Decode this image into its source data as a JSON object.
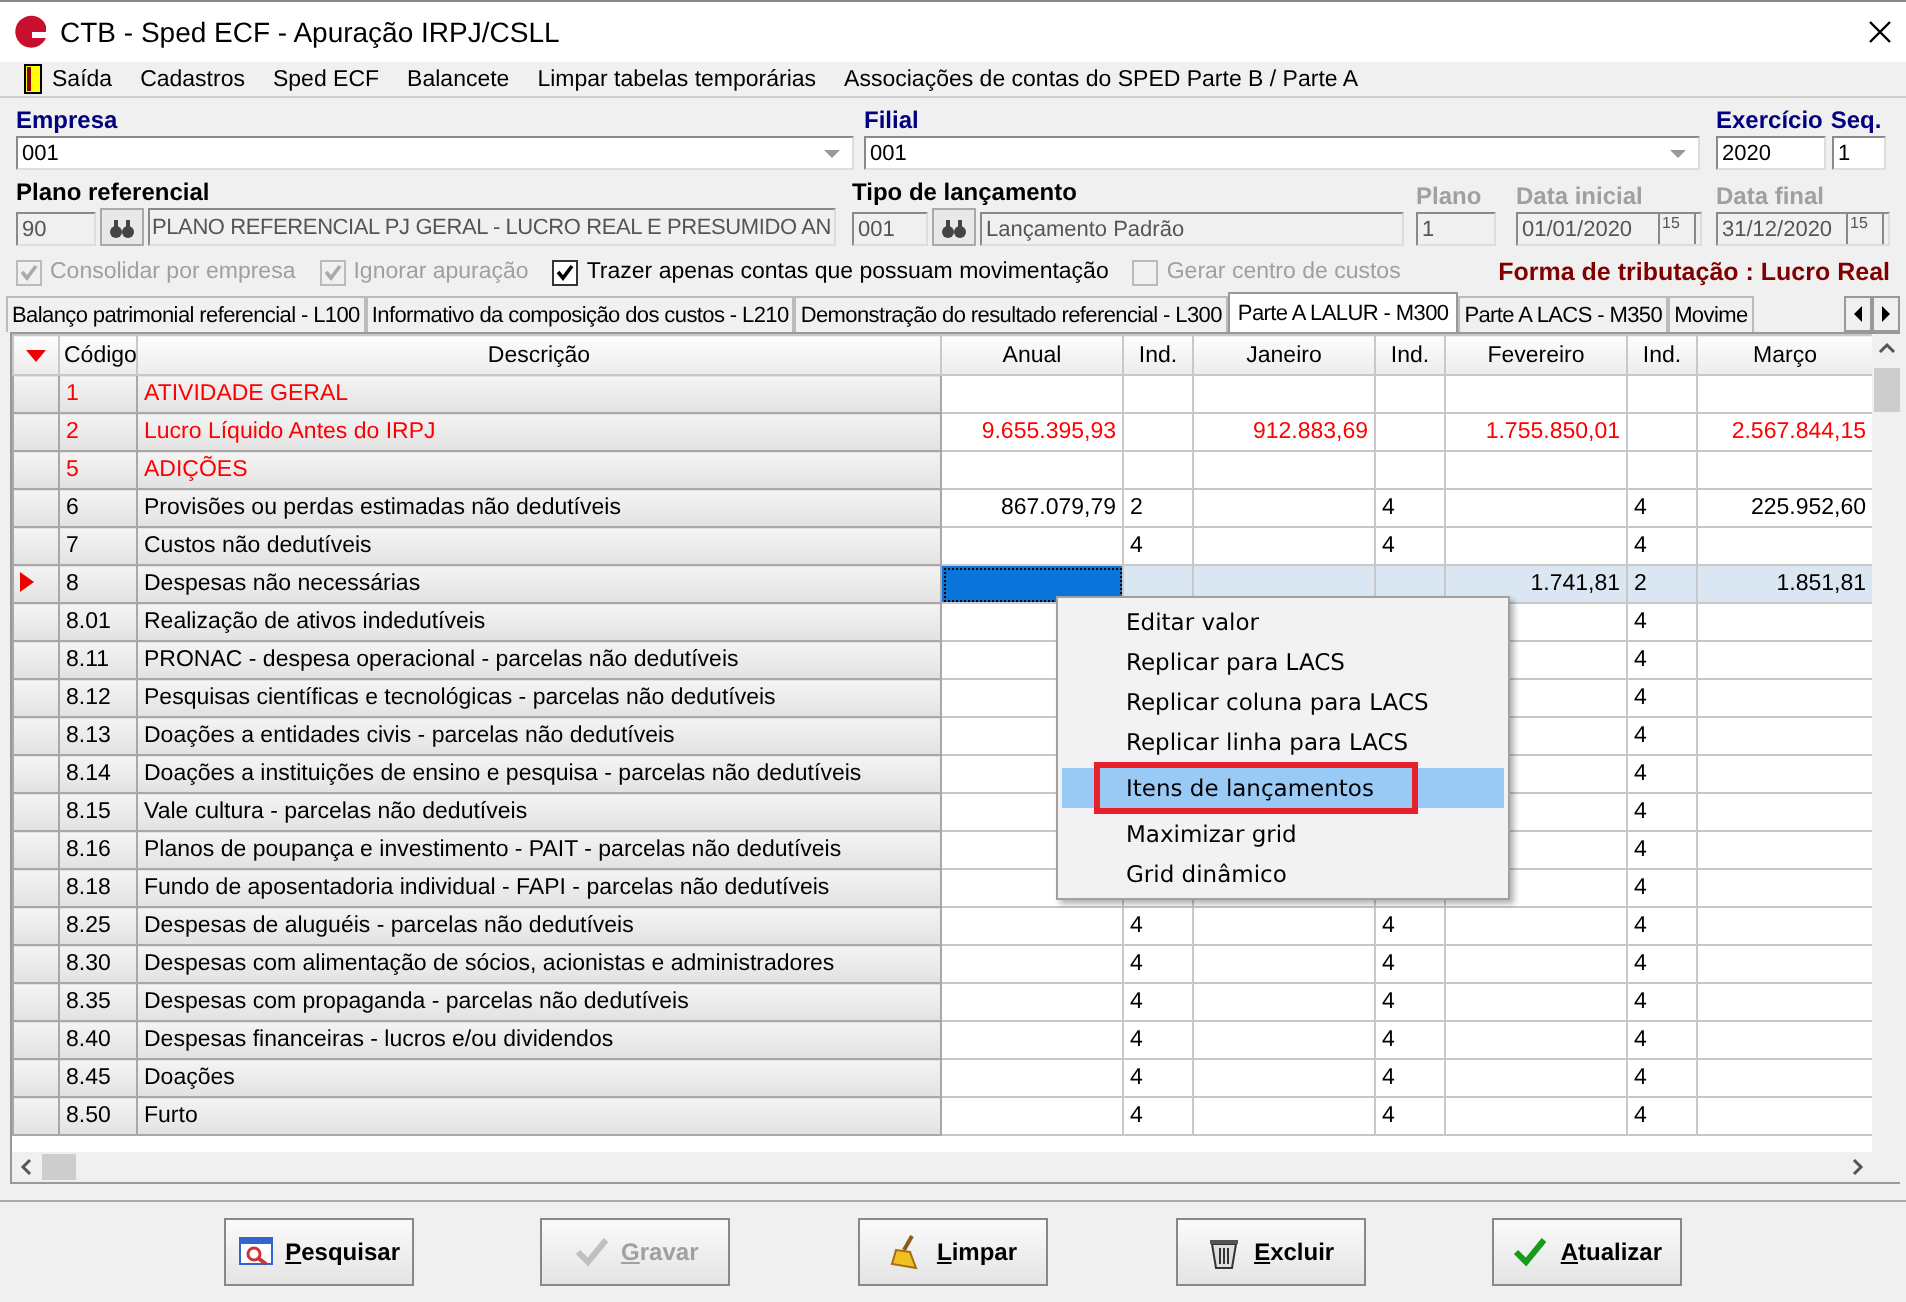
{
  "window": {
    "title": "CTB - Sped ECF - Apuração IRPJ/CSLL"
  },
  "menu_bar": [
    {
      "label": "Saída",
      "kind": "exit"
    },
    {
      "label": "Cadastros"
    },
    {
      "label": "Sped ECF"
    },
    {
      "label": "Balancete"
    },
    {
      "label": "Limpar tabelas temporárias"
    },
    {
      "label": "Associações de contas do SPED Parte B / Parte A"
    }
  ],
  "form": {
    "empresa": {
      "label": "Empresa",
      "value": "001"
    },
    "filial": {
      "label": "Filial",
      "value": "001"
    },
    "exercicio": {
      "label": "Exercício",
      "value": "2020"
    },
    "seq": {
      "label": "Seq.",
      "value": "1"
    },
    "plano_referencial": {
      "label": "Plano referencial",
      "code": "90",
      "value": "PLANO REFERENCIAL PJ GERAL - LUCRO REAL E PRESUMIDO AN"
    },
    "tipo_lancamento": {
      "label": "Tipo de lançamento",
      "code": "001",
      "value": "Lançamento Padrão"
    },
    "plano": {
      "label": "Plano",
      "value": "1",
      "disabled": true
    },
    "data_inicial": {
      "label": "Data inicial",
      "value": "01/01/2020",
      "disabled": true,
      "button": "15"
    },
    "data_final": {
      "label": "Data final",
      "value": "31/12/2020",
      "disabled": true,
      "button": "15"
    },
    "checkboxes": [
      {
        "label": "Consolidar por empresa",
        "checked": true,
        "disabled": true
      },
      {
        "label": "Ignorar apuração",
        "checked": true,
        "disabled": true
      },
      {
        "label": "Trazer apenas contas que possuam movimentação",
        "checked": true,
        "disabled": false
      },
      {
        "label": "Gerar centro de custos",
        "checked": false,
        "disabled": true
      }
    ],
    "forma_tributacao": "Forma de tributação : Lucro Real"
  },
  "tabs": [
    {
      "label": "Balanço patrimonial referencial - L100",
      "selected": false
    },
    {
      "label": "Informativo da composição dos custos - L210",
      "selected": false
    },
    {
      "label": "Demonstração do resultado referencial - L300",
      "selected": false
    },
    {
      "label": "Parte A LALUR - M300",
      "selected": true
    },
    {
      "label": "Parte A LACS - M350",
      "selected": false
    },
    {
      "label": "Movime",
      "selected": false
    }
  ],
  "table": {
    "columns": [
      "Código",
      "Descrição",
      "Anual",
      "Ind.",
      "Janeiro",
      "Ind.",
      "Fevereiro",
      "Ind.",
      "Março"
    ],
    "rows": [
      {
        "kind": "group",
        "current": false,
        "cells": [
          "1",
          "ATIVIDADE GERAL"
        ]
      },
      {
        "kind": "group",
        "current": false,
        "cells": [
          "2",
          "Lucro Líquido Antes do IRPJ",
          "9.655.395,93",
          null,
          "912.883,69",
          null,
          "1.755.850,01",
          null,
          "2.567.844,15"
        ]
      },
      {
        "kind": "group",
        "current": false,
        "cells": [
          "5",
          "ADIÇÕES"
        ]
      },
      {
        "kind": "item",
        "current": false,
        "cells": [
          "6",
          "Provisões ou perdas estimadas não dedutíveis",
          "867.079,79",
          "2",
          null,
          "4",
          null,
          "4",
          "225.952,60"
        ]
      },
      {
        "kind": "item",
        "current": false,
        "cells": [
          "7",
          "Custos não dedutíveis",
          null,
          "4",
          null,
          "4",
          null,
          "4"
        ]
      },
      {
        "kind": "item",
        "current": true,
        "cells": [
          "8",
          "Despesas não necessárias",
          null,
          null,
          null,
          null,
          "1.741,81",
          "2",
          "1.851,81"
        ]
      },
      {
        "kind": "item",
        "current": false,
        "cells": [
          "8.01",
          "Realização de ativos indedutíveis",
          null,
          null,
          null,
          null,
          null,
          "4"
        ]
      },
      {
        "kind": "item",
        "current": false,
        "cells": [
          "8.11",
          "PRONAC - despesa operacional - parcelas não dedutíveis",
          null,
          null,
          null,
          null,
          null,
          "4"
        ]
      },
      {
        "kind": "item",
        "current": false,
        "cells": [
          "8.12",
          "Pesquisas científicas e tecnológicas - parcelas não dedutíveis",
          null,
          null,
          null,
          null,
          null,
          "4"
        ]
      },
      {
        "kind": "item",
        "current": false,
        "cells": [
          "8.13",
          "Doações a entidades civis - parcelas não dedutíveis",
          null,
          null,
          null,
          null,
          null,
          "4"
        ]
      },
      {
        "kind": "item",
        "current": false,
        "cells": [
          "8.14",
          "Doações a instituições de ensino e pesquisa - parcelas não dedutíveis",
          null,
          null,
          null,
          null,
          null,
          "4"
        ]
      },
      {
        "kind": "item",
        "current": false,
        "cells": [
          "8.15",
          "Vale cultura - parcelas não dedutíveis",
          null,
          null,
          null,
          null,
          null,
          "4"
        ]
      },
      {
        "kind": "item",
        "current": false,
        "cells": [
          "8.16",
          "Planos de poupança e investimento - PAIT - parcelas não dedutíveis",
          null,
          null,
          null,
          null,
          null,
          "4"
        ]
      },
      {
        "kind": "item",
        "current": false,
        "cells": [
          "8.18",
          "Fundo de aposentadoria individual - FAPI - parcelas não dedutíveis",
          null,
          null,
          null,
          null,
          null,
          "4"
        ]
      },
      {
        "kind": "item",
        "current": false,
        "cells": [
          "8.25",
          "Despesas de aluguéis - parcelas não dedutíveis",
          null,
          "4",
          null,
          "4",
          null,
          "4"
        ]
      },
      {
        "kind": "item",
        "current": false,
        "cells": [
          "8.30",
          "Despesas com alimentação de sócios, acionistas e administradores",
          null,
          "4",
          null,
          "4",
          null,
          "4"
        ]
      },
      {
        "kind": "item",
        "current": false,
        "cells": [
          "8.35",
          "Despesas com propaganda - parcelas não dedutíveis",
          null,
          "4",
          null,
          "4",
          null,
          "4"
        ]
      },
      {
        "kind": "item",
        "current": false,
        "cells": [
          "8.40",
          "Despesas financeiras - lucros e/ou dividendos",
          null,
          "4",
          null,
          "4",
          null,
          "4"
        ]
      },
      {
        "kind": "item",
        "current": false,
        "cells": [
          "8.45",
          "Doações",
          null,
          "4",
          null,
          "4",
          null,
          "4"
        ]
      },
      {
        "kind": "item",
        "current": false,
        "cells": [
          "8.50",
          "Furto",
          null,
          "4",
          null,
          "4",
          null,
          "4"
        ]
      }
    ]
  },
  "context_menu": {
    "items": [
      {
        "label": "Editar valor",
        "selected": false
      },
      {
        "label": "Replicar para LACS",
        "selected": false
      },
      {
        "label": "Replicar coluna para LACS",
        "selected": false
      },
      {
        "label": "Replicar linha para LACS",
        "selected": false
      },
      {
        "label": "Itens de lançamentos",
        "selected": true
      },
      {
        "label": "Maximizar grid",
        "selected": false
      },
      {
        "label": "Grid dinâmico",
        "selected": false
      }
    ]
  },
  "buttons": [
    {
      "label": "Pesquisar",
      "kind": "search",
      "disabled": false
    },
    {
      "label": "Gravar",
      "kind": "check",
      "disabled": true
    },
    {
      "label": "Limpar",
      "kind": "broom",
      "disabled": false
    },
    {
      "label": "Excluir",
      "kind": "trash",
      "disabled": false
    },
    {
      "label": "Atualizar",
      "kind": "check",
      "disabled": false
    }
  ]
}
